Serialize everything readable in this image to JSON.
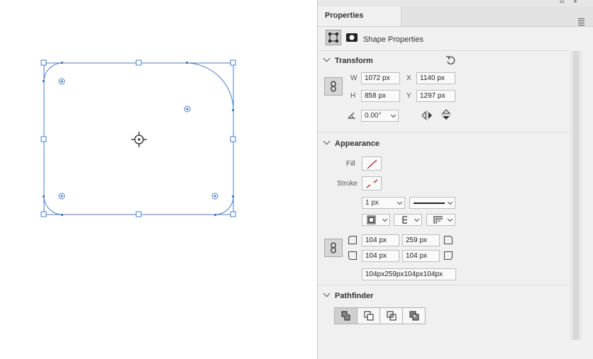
{
  "panel": {
    "tab_title": "Properties",
    "shape_properties_label": "Shape Properties"
  },
  "transform": {
    "title": "Transform",
    "w_label": "W",
    "w_value": "1072 px",
    "h_label": "H",
    "h_value": "858 px",
    "x_label": "X",
    "x_value": "1140 px",
    "y_label": "Y",
    "y_value": "1297 px",
    "rotation_value": "0.00°"
  },
  "appearance": {
    "title": "Appearance",
    "fill_label": "Fill",
    "stroke_label": "Stroke",
    "stroke_width_value": "1 px",
    "corner_tl": "104 px",
    "corner_tr": "259 px",
    "corner_bl": "104 px",
    "corner_br": "104 px",
    "corner_summary": "104px259px104px104px"
  },
  "pathfinder": {
    "title": "Pathfinder"
  },
  "colors": {
    "selection_blue": "#4a7cc9",
    "no_color_red": "#b83a3a"
  }
}
